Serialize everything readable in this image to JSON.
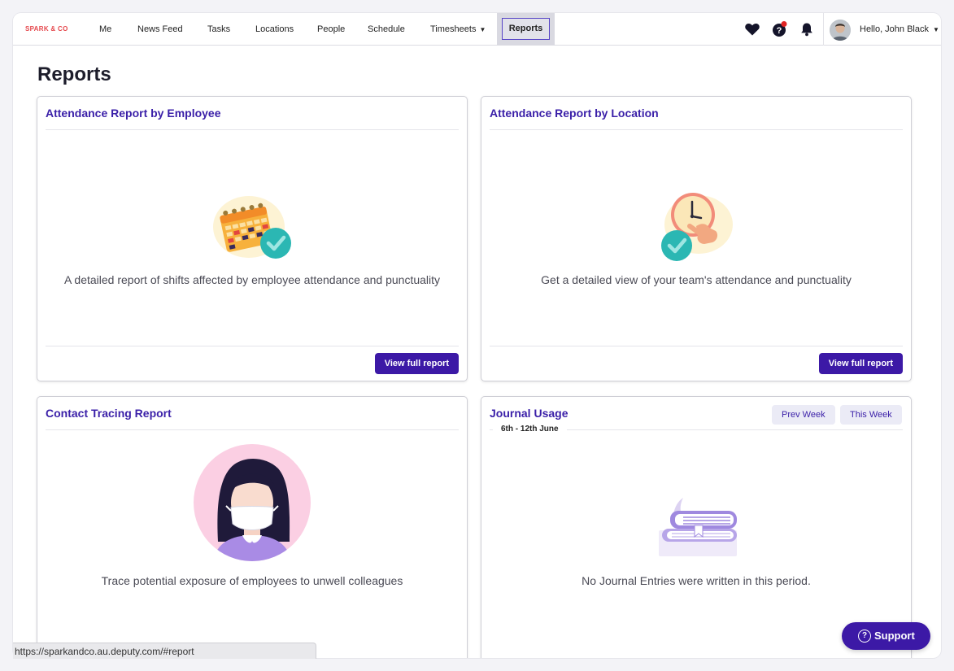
{
  "nav": {
    "brand": "SPARK & CO",
    "items": [
      {
        "label": "Me"
      },
      {
        "label": "News Feed"
      },
      {
        "label": "Tasks"
      },
      {
        "label": "Locations"
      },
      {
        "label": "People"
      },
      {
        "label": "Schedule"
      },
      {
        "label": "Timesheets"
      },
      {
        "label": "Reports"
      }
    ],
    "icons": [
      "heart-icon",
      "help-icon",
      "bell-icon"
    ],
    "greeting": "Hello, John Black"
  },
  "page": {
    "title": "Reports"
  },
  "cards": [
    {
      "title": "Attendance Report by Employee",
      "description": "A detailed report of shifts affected by employee attendance and punctuality",
      "button": "View full report",
      "illustration": "calendar-check-illustration"
    },
    {
      "title": "Attendance Report by Location",
      "description": "Get a detailed view of your team's attendance and punctuality",
      "button": "View full report",
      "illustration": "clock-check-illustration"
    },
    {
      "title": "Contact Tracing Report",
      "description": "Trace potential exposure of employees to unwell colleagues",
      "illustration": "masked-person-illustration"
    },
    {
      "title": "Journal Usage",
      "date_range": "6th - 12th June",
      "prev_week": "Prev Week",
      "this_week": "This Week",
      "empty_message": "No Journal Entries were written in this period.",
      "illustration": "journal-books-illustration"
    }
  ],
  "statusbar": {
    "url": "https://sparkandco.au.deputy.com/#report"
  },
  "support": {
    "label": "Support"
  },
  "colors": {
    "accent": "#3c19a6",
    "title": "#3a1fa8",
    "brand": "#e5484d",
    "teal": "#2bb7b3"
  }
}
